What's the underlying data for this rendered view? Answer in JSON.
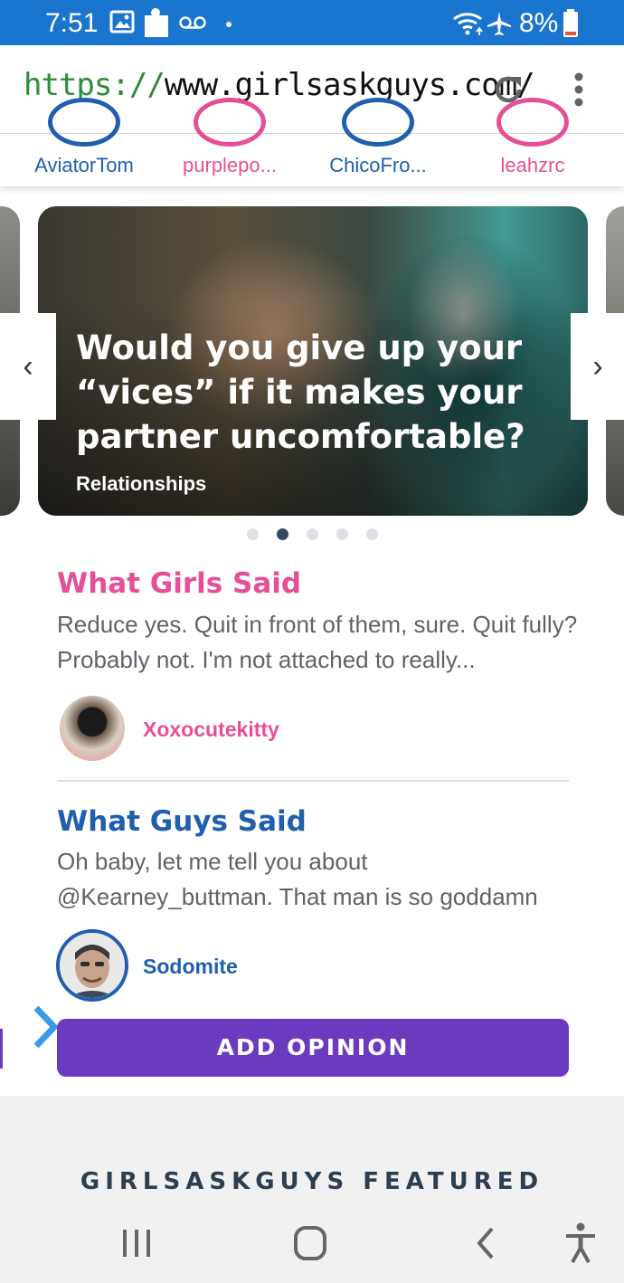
{
  "status_bar": {
    "time": "7:51",
    "battery": "8%",
    "icons": [
      "image-icon",
      "puzzle-icon",
      "voicemail-icon",
      "dot-icon",
      "wifi-icon",
      "airplane-icon",
      "battery-icon"
    ]
  },
  "browser": {
    "url_scheme": "https://",
    "url_rest": "www.girlsaskguys.com/",
    "reload_icon": "reload-icon",
    "menu_icon": "more-vertical-icon"
  },
  "users": [
    {
      "name": "AviatorTom",
      "color": "#1f5fad"
    },
    {
      "name": "purplepo...",
      "color": "#e64f97"
    },
    {
      "name": "ChicoFro...",
      "color": "#1f5fad"
    },
    {
      "name": "leahzrc",
      "color": "#e64f97"
    }
  ],
  "carousel": {
    "title": "Would you give up your “vices” if it makes your partner uncomfortable?",
    "category": "Relationships",
    "prev_label": "‹",
    "next_label": "›",
    "slide_count": 5,
    "active_index": 1
  },
  "girls_opinion": {
    "heading": "What Girls Said",
    "text": "Reduce yes. Quit in front of them, sure. Quit fully? Probably not. I'm not attached to really...",
    "author": "Xoxocutekitty"
  },
  "guys_opinion": {
    "heading": "What Guys Said",
    "text": "Oh baby, let me tell you about @Kearney_buttman. That man is so goddamn",
    "author": "Sodomite"
  },
  "add_opinion_label": "ADD OPINION",
  "featured_heading": "GIRLSASKGUYS FEATURED",
  "nav_bar": [
    "recent-apps-icon",
    "home-icon",
    "back-icon",
    "accessibility-icon"
  ],
  "colors": {
    "status_bar": "#1a75cf",
    "girl_accent": "#e64f97",
    "guy_accent": "#1f5fad",
    "button": "#6a3bbf",
    "url_scheme": "#2e8b3a"
  }
}
